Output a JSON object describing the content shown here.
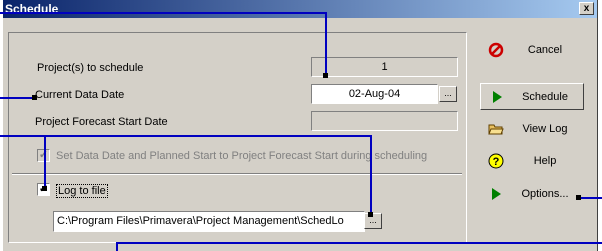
{
  "dialog": {
    "title": "Schedule",
    "close_label": "x"
  },
  "fields": {
    "projects_label": "Project(s) to schedule",
    "projects_value": "1",
    "data_date_label": "Current Data Date",
    "data_date_value": "02-Aug-04",
    "forecast_label": "Project Forecast Start Date",
    "forecast_value": "",
    "set_date_label": "Set Data Date and Planned Start to Project Forecast Start during scheduling",
    "log_label": "Log to file",
    "log_path": "C:\\Program Files\\Primavera\\Project Management\\SchedLo",
    "browse_label": "...",
    "log_checked_mark": "✓"
  },
  "buttons": {
    "cancel": "Cancel",
    "schedule": "Schedule",
    "view_log": "View Log",
    "help": "Help",
    "options": "Options..."
  },
  "colors": {
    "callout": "#0000c0",
    "cancel_icon": "#cc0000",
    "play_icon": "#008000",
    "help_icon": "#ffff00"
  }
}
